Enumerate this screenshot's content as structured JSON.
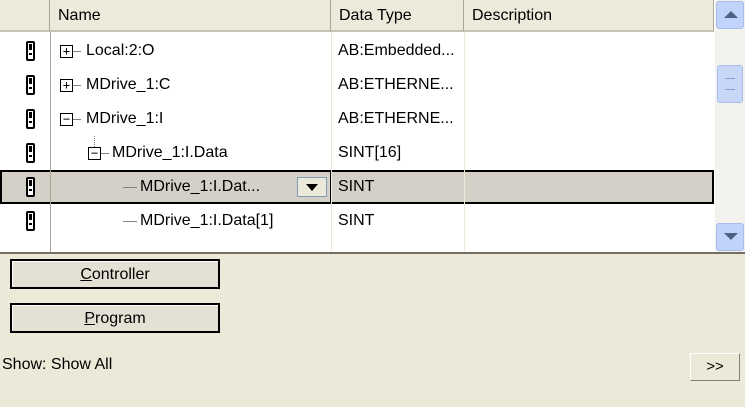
{
  "columns": {
    "name": "Name",
    "data_type": "Data Type",
    "description": "Description"
  },
  "rows": [
    {
      "name": "Local:2:O",
      "data_type": "AB:Embedded...",
      "expander": "+",
      "level": 0
    },
    {
      "name": "MDrive_1:C",
      "data_type": "AB:ETHERNE...",
      "expander": "+",
      "level": 0
    },
    {
      "name": "MDrive_1:I",
      "data_type": "AB:ETHERNE...",
      "expander": "−",
      "level": 0
    },
    {
      "name": "MDrive_1:I.Data",
      "data_type": "SINT[16]",
      "expander": "−",
      "level": 1
    },
    {
      "name": "MDrive_1:I.Dat...",
      "data_type": "SINT",
      "expander": "",
      "level": 2,
      "selected": true
    },
    {
      "name": "MDrive_1:I.Data[1]",
      "data_type": "SINT",
      "expander": "",
      "level": 2
    }
  ],
  "buttons": {
    "controller": {
      "underline": "C",
      "rest": "ontroller"
    },
    "program": {
      "underline": "P",
      "rest": "rogram"
    }
  },
  "show": {
    "label": "Show: Show All"
  },
  "more_button": ">>",
  "colors": {
    "window_bg": "#ECE9D8",
    "grid_bg": "#FFFFFF",
    "selected_row": "#D4D0C8",
    "scrollbar_accent": "#C1D3FB"
  },
  "icons": {
    "tag": "tag-icon",
    "expand": "plus-box-icon",
    "collapse": "minus-box-icon",
    "dropdown": "chevron-down-icon",
    "scroll_up": "chevron-up-icon",
    "scroll_down": "chevron-down-icon"
  }
}
